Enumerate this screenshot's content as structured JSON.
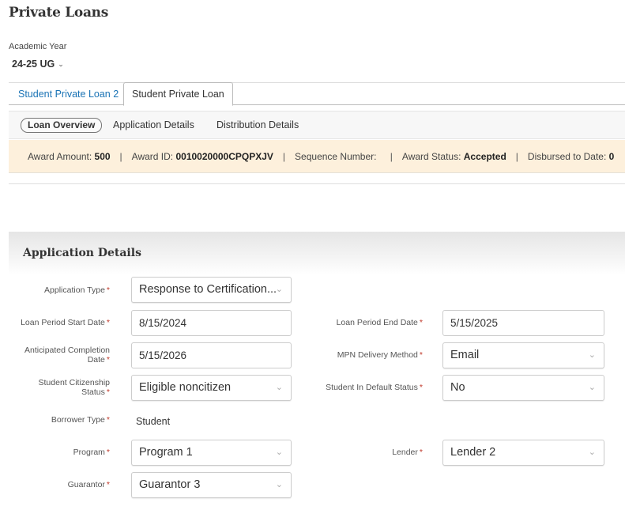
{
  "page": {
    "title": "Private Loans"
  },
  "academic_year": {
    "label": "Academic Year",
    "value": "24-25 UG",
    "chevron_icon": "chevron-down-icon"
  },
  "tabs": [
    {
      "label": "Student Private Loan 2",
      "active": false
    },
    {
      "label": "Student Private Loan",
      "active": true
    }
  ],
  "subnav": [
    {
      "label": "Loan Overview",
      "active": true
    },
    {
      "label": "Application Details",
      "active": false
    },
    {
      "label": "Distribution Details",
      "active": false
    }
  ],
  "summary": {
    "separator": "|",
    "award_amount_label": "Award Amount:",
    "award_amount": "500",
    "award_id_label": "Award ID:",
    "award_id": "0010020000CPQPXJV",
    "sequence_number_label": "Sequence Number:",
    "sequence_number": "",
    "award_status_label": "Award Status:",
    "award_status": "Accepted",
    "disbursed_label": "Disbursed to Date:",
    "disbursed": "0"
  },
  "application_details": {
    "title": "Application Details",
    "required_marker": "*",
    "fields": {
      "application_type": {
        "label": "Application Type",
        "value": "Response to Certification..."
      },
      "loan_period_start": {
        "label": "Loan Period Start Date",
        "value": "8/15/2024"
      },
      "loan_period_end": {
        "label": "Loan Period End Date",
        "value": "5/15/2025"
      },
      "anticipated_completion": {
        "label_line1": "Anticipated Completion",
        "label_line2": "Date",
        "value": "5/15/2026"
      },
      "mpn_delivery": {
        "label": "MPN Delivery Method",
        "value": "Email"
      },
      "citizenship": {
        "label_line1": "Student Citizenship",
        "label_line2": "Status",
        "value": "Eligible noncitizen"
      },
      "default_status": {
        "label": "Student In Default Status",
        "value": "No"
      },
      "borrower_type": {
        "label": "Borrower Type",
        "value": "Student"
      },
      "program": {
        "label": "Program",
        "value": "Program 1"
      },
      "lender": {
        "label": "Lender",
        "value": "Lender 2"
      },
      "guarantor": {
        "label": "Guarantor",
        "value": "Guarantor 3"
      }
    }
  },
  "colors": {
    "link": "#1a73b5",
    "summary_bg": "#fdf0dc",
    "required": "#c0392b"
  }
}
